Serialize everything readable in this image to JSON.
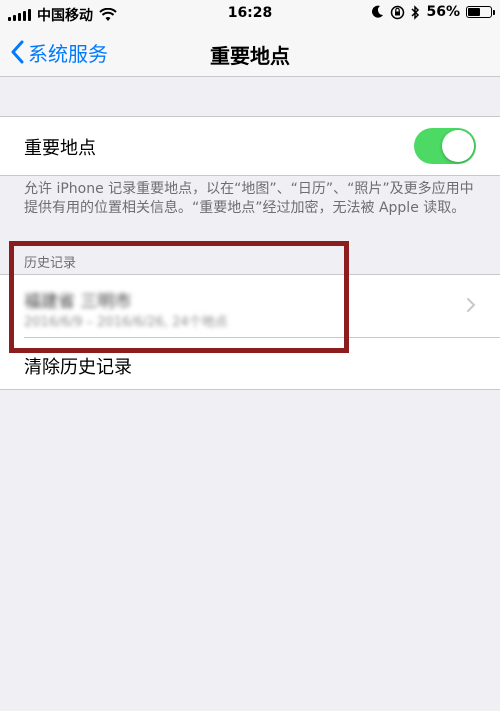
{
  "status_bar": {
    "carrier": "中国移动",
    "time": "16:28",
    "battery": "56%",
    "battery_level": 0.56
  },
  "nav": {
    "back_label": "系统服务",
    "title": "重要地点"
  },
  "settings": {
    "toggle_label": "重要地点",
    "toggle_on": true,
    "footer_note": "允许 iPhone 记录重要地点，以在“地图”、“日历”、“照片”及更多应用中提供有用的位置相关信息。“重要地点”经过加密，无法被 Apple 读取。"
  },
  "history": {
    "header": "历史记录",
    "items": [
      {
        "title": "福建省 三明市",
        "subtitle": "2016/6/9 – 2016/6/26, 24个地点"
      }
    ],
    "clear_label": "清除历史记录"
  },
  "colors": {
    "accent": "#007aff",
    "toggle_on": "#4cd964",
    "highlight": "#8b1d1f",
    "background": "#efeff4"
  }
}
